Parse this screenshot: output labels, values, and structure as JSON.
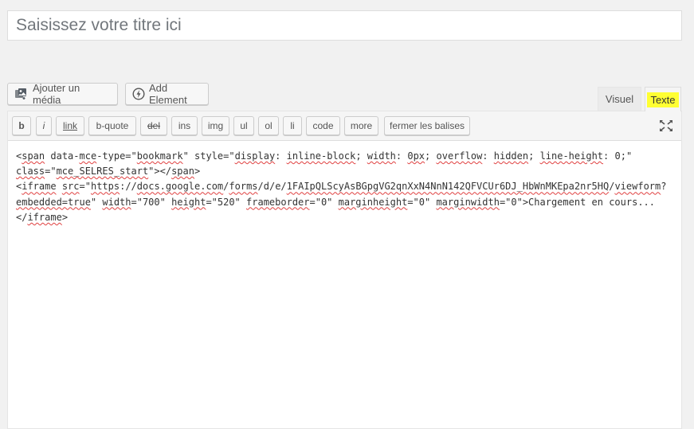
{
  "title_placeholder": "Saisissez votre titre ici",
  "buttons": {
    "add_media": "Ajouter un média",
    "add_element": "Add Element"
  },
  "tabs": {
    "visual": "Visuel",
    "text": "Texte",
    "active": "Texte",
    "highlight_color": "#ffff33"
  },
  "quicktags": [
    "b",
    "i",
    "link",
    "b-quote",
    "del",
    "ins",
    "img",
    "ul",
    "ol",
    "li",
    "code",
    "more",
    "fermer les balises"
  ],
  "code": {
    "lines": [
      [
        {
          "t": "<"
        },
        {
          "t": "span",
          "s": 1
        },
        {
          "t": " data-"
        },
        {
          "t": "mce",
          "s": 1
        },
        {
          "t": "-type=\""
        },
        {
          "t": "bookmark",
          "s": 1
        },
        {
          "t": "\" style=\""
        },
        {
          "t": "display",
          "s": 1
        },
        {
          "t": ": "
        },
        {
          "t": "inline-block",
          "s": 1
        },
        {
          "t": "; "
        },
        {
          "t": "width",
          "s": 1
        },
        {
          "t": ": "
        },
        {
          "t": "0px",
          "s": 1
        },
        {
          "t": "; "
        },
        {
          "t": "overflow",
          "s": 1
        },
        {
          "t": ": "
        },
        {
          "t": "hidden",
          "s": 1
        },
        {
          "t": "; "
        },
        {
          "t": "line-height",
          "s": 1
        },
        {
          "t": ": 0;\""
        }
      ],
      [
        {
          "t": "class",
          "s": 1
        },
        {
          "t": "=\""
        },
        {
          "t": "mce_SELRES_start",
          "s": 1
        },
        {
          "t": "\"></"
        },
        {
          "t": "span",
          "s": 1
        },
        {
          "t": ">"
        }
      ],
      [
        {
          "t": "<"
        },
        {
          "t": "iframe",
          "s": 1
        },
        {
          "t": " "
        },
        {
          "t": "src",
          "s": 1
        },
        {
          "t": "=\""
        },
        {
          "t": "https",
          "s": 1
        },
        {
          "t": "://"
        },
        {
          "t": "docs.google.com",
          "s": 1
        },
        {
          "t": "/"
        },
        {
          "t": "forms",
          "s": 1
        },
        {
          "t": "/d/e/"
        },
        {
          "t": "1FAIpQLScyAsBGpgVG2qnXxN4NnN142QFVCUr6DJ_HbWnMKEpa2nr5HQ",
          "s": 1
        },
        {
          "t": "/"
        },
        {
          "t": "viewform",
          "s": 1
        },
        {
          "t": "?"
        }
      ],
      [
        {
          "t": "embedded=true",
          "s": 1
        },
        {
          "t": "\" "
        },
        {
          "t": "width",
          "s": 1
        },
        {
          "t": "=\"700\" "
        },
        {
          "t": "height",
          "s": 1
        },
        {
          "t": "=\"520\" "
        },
        {
          "t": "frameborder",
          "s": 1
        },
        {
          "t": "=\"0\" "
        },
        {
          "t": "marginheight",
          "s": 1
        },
        {
          "t": "=\"0\" "
        },
        {
          "t": "marginwidth",
          "s": 1
        },
        {
          "t": "=\"0\">Chargement en cours..."
        }
      ],
      [
        {
          "t": "</"
        },
        {
          "t": "iframe",
          "s": 1
        },
        {
          "t": ">"
        }
      ]
    ]
  }
}
